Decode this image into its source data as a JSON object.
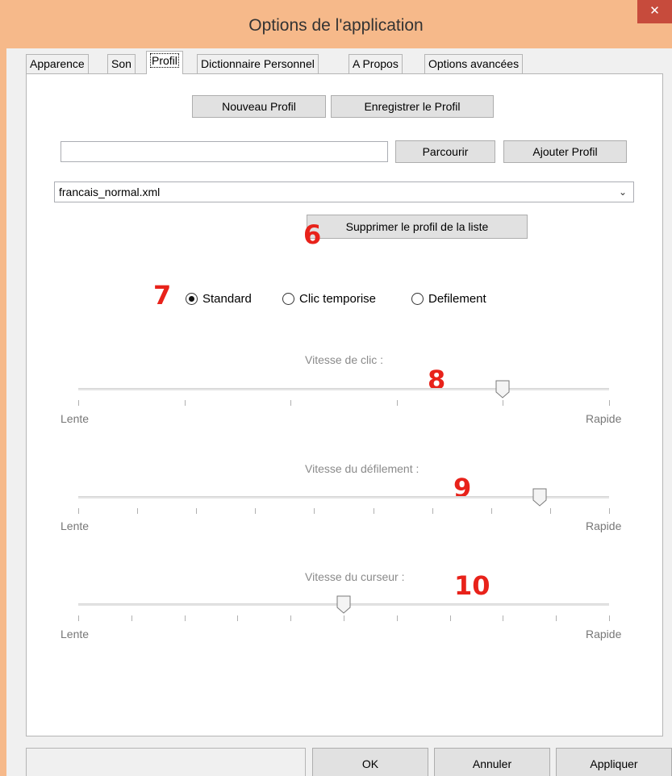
{
  "window": {
    "title": "Options de l'application",
    "close_glyph": "✕"
  },
  "tabs": [
    {
      "label": "Apparence"
    },
    {
      "label": "Son"
    },
    {
      "label": "Profil",
      "active": true
    },
    {
      "label": "Dictionnaire Personnel"
    },
    {
      "label": "A Propos"
    },
    {
      "label": "Options avancées"
    }
  ],
  "profile": {
    "new_profile_label": "Nouveau Profil",
    "save_profile_label": "Enregistrer le Profil",
    "path_value": "",
    "browse_label": "Parcourir",
    "add_profile_label": "Ajouter Profil",
    "selected_profile": "francais_normal.xml",
    "remove_profile_label": "Supprimer le profil de la liste"
  },
  "mode": {
    "options": [
      "Standard",
      "Clic temporise",
      "Defilement"
    ],
    "selected": "Standard"
  },
  "sliders": [
    {
      "label": "Vitesse de clic :",
      "min_label": "Lente",
      "max_label": "Rapide",
      "ticks": 6,
      "value_fraction": 0.8
    },
    {
      "label": "Vitesse du défilement :",
      "min_label": "Lente",
      "max_label": "Rapide",
      "ticks": 10,
      "value_fraction": 0.87
    },
    {
      "label": "Vitesse du curseur :",
      "min_label": "Lente",
      "max_label": "Rapide",
      "ticks": 11,
      "value_fraction": 0.5
    }
  ],
  "callouts": [
    "6",
    "7",
    "8",
    "9",
    "10"
  ],
  "footer": {
    "ok_label": "OK",
    "cancel_label": "Annuler",
    "apply_label": "Appliquer"
  },
  "colors": {
    "title_bar": "#f6b98a",
    "close_button": "#c74b3c",
    "callout_red": "#e8221a"
  }
}
